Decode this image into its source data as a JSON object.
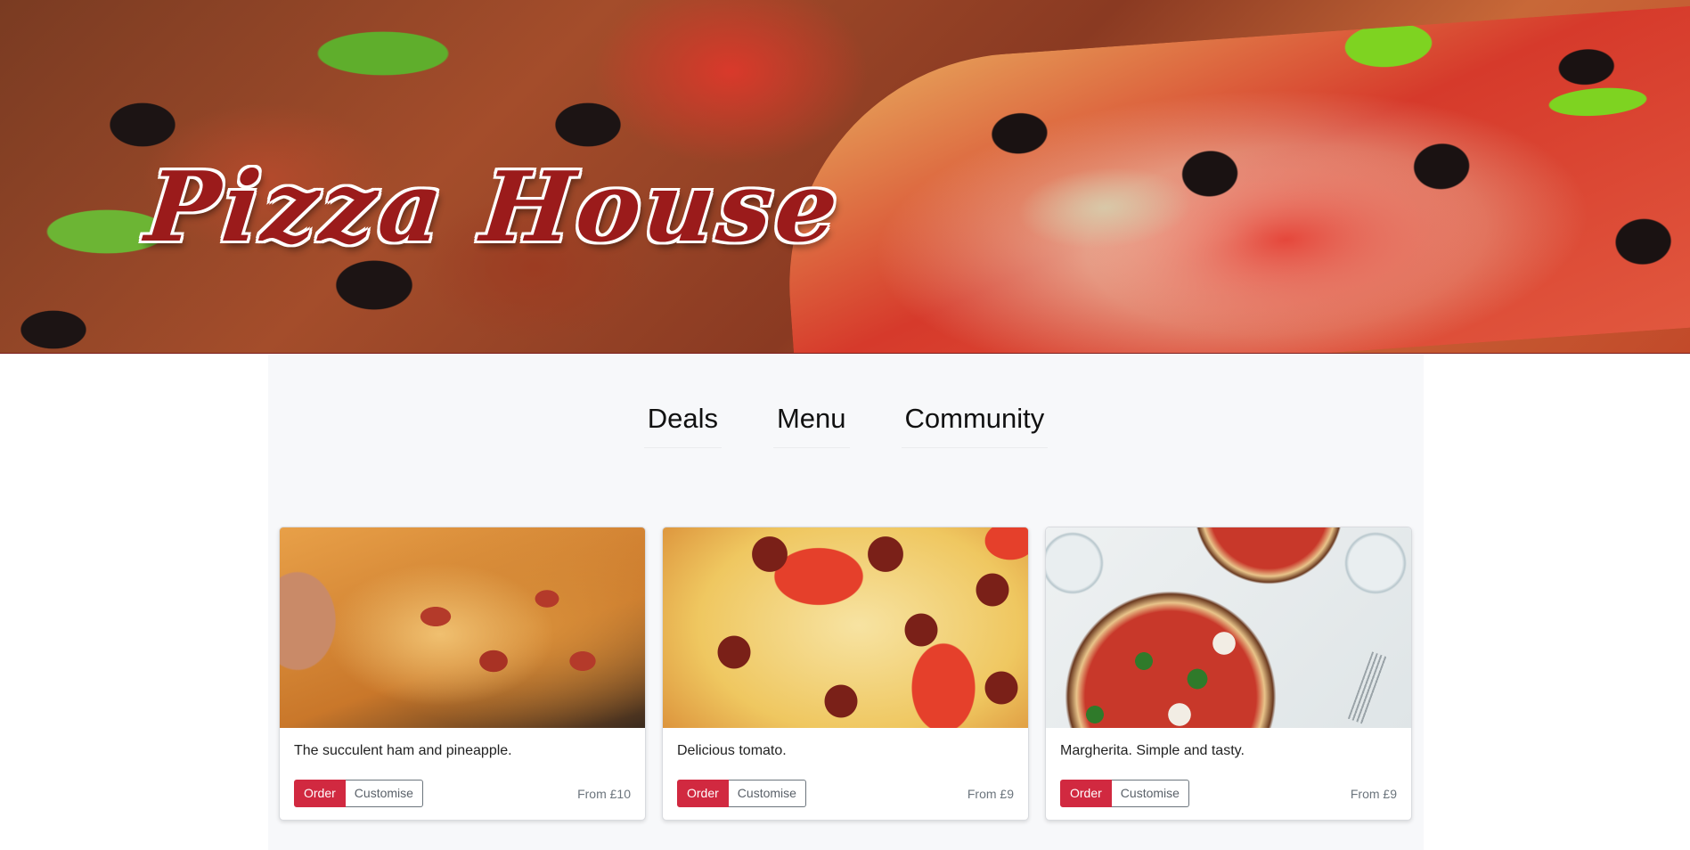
{
  "header": {
    "title": "Pizza House"
  },
  "nav": {
    "items": [
      {
        "label": "Deals"
      },
      {
        "label": "Menu"
      },
      {
        "label": "Community"
      }
    ]
  },
  "cards": [
    {
      "description": "The succulent ham and pineapple.",
      "order_label": "Order",
      "customise_label": "Customise",
      "price": "From £10",
      "image_icon": "ham-pineapple-pizza-photo"
    },
    {
      "description": "Delicious tomato.",
      "order_label": "Order",
      "customise_label": "Customise",
      "price": "From £9",
      "image_icon": "pepperoni-tomato-pizza-photo"
    },
    {
      "description": "Margherita. Simple and tasty.",
      "order_label": "Order",
      "customise_label": "Customise",
      "price": "From £9",
      "image_icon": "margherita-pizza-photo"
    }
  ],
  "colors": {
    "brand": "#9b1b1b",
    "order_button": "#d12940",
    "panel_background": "#f7f8fa"
  }
}
